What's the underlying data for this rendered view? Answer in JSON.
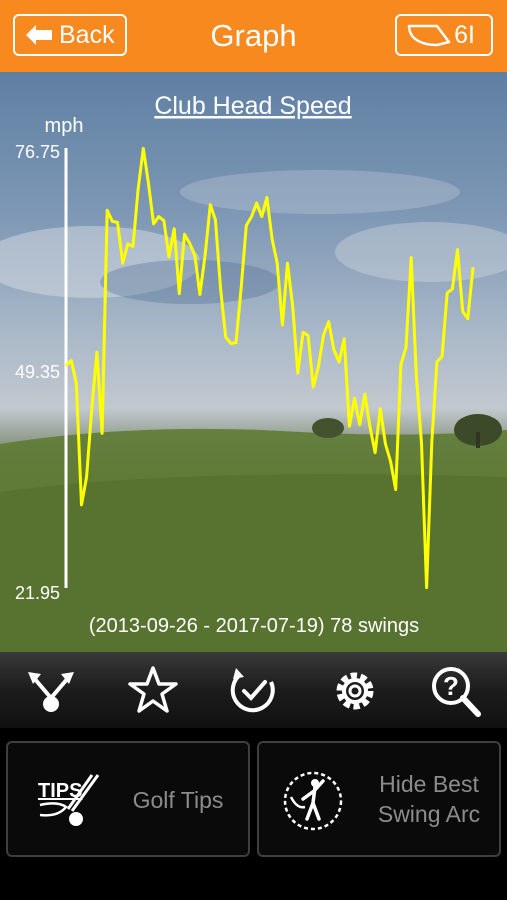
{
  "header": {
    "back_label": "Back",
    "title": "Graph",
    "club_label": "6I",
    "background_color": "#f7891f"
  },
  "toolbar": {
    "icons": [
      "share-nodes-icon",
      "star-icon",
      "history-clock-icon",
      "gear-icon",
      "help-search-icon"
    ]
  },
  "bottom_panel": {
    "tips_label": "Golf Tips",
    "tips_icon_text": "TIPS",
    "arc_label_line1": "Hide Best",
    "arc_label_line2": "Swing Arc"
  },
  "chart_data": {
    "type": "line",
    "title": "Club Head Speed",
    "ylabel": "mph",
    "ylim": [
      21.95,
      76.75
    ],
    "y_ticks": [
      "76.75",
      "49.35",
      "21.95"
    ],
    "line_color": "#ffff00",
    "summary": "(2013-09-26 - 2017-07-19) 78 swings",
    "series": [
      {
        "values": [
          49.6,
          50.3,
          47.5,
          32.3,
          35.8,
          44.3,
          51.3,
          41.2,
          69.0,
          67.6,
          67.5,
          62.4,
          64.8,
          64.5,
          71.6,
          76.7,
          72.4,
          67.3,
          68.2,
          67.7,
          63.2,
          66.7,
          58.6,
          66.0,
          64.9,
          63.4,
          58.5,
          63.4,
          69.7,
          67.8,
          59.2,
          53.2,
          52.4,
          52.5,
          59.4,
          67.1,
          68.2,
          69.9,
          68.2,
          70.6,
          65.4,
          62.4,
          54.7,
          62.4,
          57.0,
          48.7,
          53.8,
          53.4,
          47.0,
          49.5,
          53.5,
          55.1,
          51.6,
          50.1,
          53.0,
          42.1,
          45.6,
          42.3,
          46.1,
          42.0,
          38.8,
          44.3,
          39.9,
          37.7,
          34.2,
          49.8,
          51.9,
          63.1,
          48.4,
          40.0,
          22.0,
          40.1,
          50.1,
          50.8,
          58.7,
          59.2,
          64.1,
          56.4,
          55.5,
          61.9
        ]
      }
    ]
  }
}
